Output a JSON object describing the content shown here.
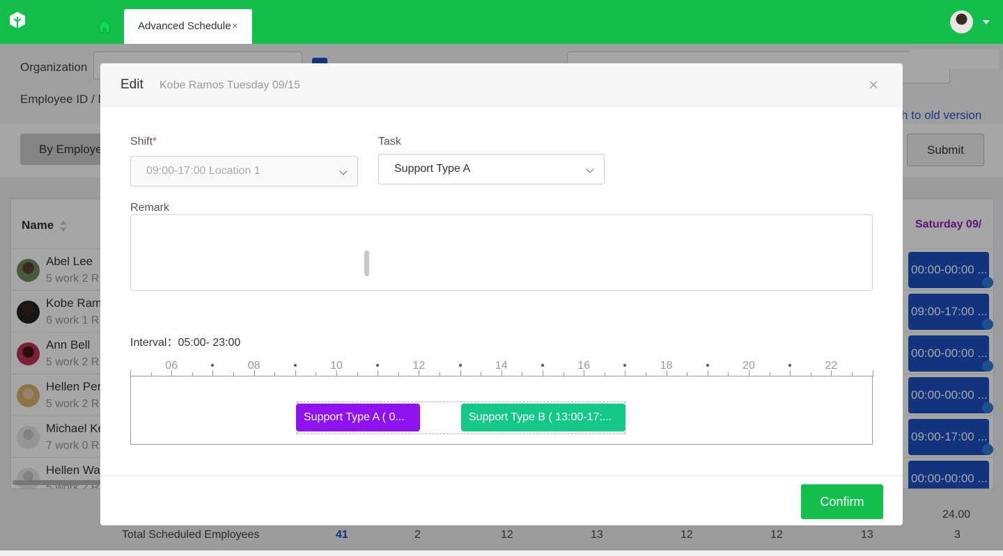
{
  "colors": {
    "brand_green": "#14be4b",
    "shift_blue": "#1d4fc2",
    "task_a_purple": "#8f12f0",
    "task_b_teal": "#14c987",
    "weekend_purple": "#8d1fb5"
  },
  "header": {
    "tab_label": "Advanced Schedule",
    "tab_close": "×",
    "icons": [
      "tree-logo-icon",
      "home-icon",
      "user-avatar",
      "caret-down-icon"
    ]
  },
  "filters": {
    "organization_label": "Organization",
    "employee_label": "Employee ID / N",
    "old_version_link": "h to old version"
  },
  "toolbar": {
    "by_employee": "By Employe",
    "submit": "Submit"
  },
  "table": {
    "name_header": "Name",
    "saturday_header": "Saturday 09/",
    "rows": [
      {
        "name": "Abel Lee",
        "sub": "5 work 2 R",
        "shift": "00:00-00:00 ..."
      },
      {
        "name": "Kobe Ram",
        "sub": "6 work 1 R",
        "shift": "09:00-17:00 ..."
      },
      {
        "name": "Ann Bell",
        "sub": "5 work 2 R",
        "shift": "00:00-00:00 ..."
      },
      {
        "name": "Hellen Per",
        "sub": "5 work 2 R",
        "shift": "00:00-00:00 ..."
      },
      {
        "name": "Michael Ke",
        "sub": "7 work 0 R",
        "shift": "09:00-17:00 ..."
      },
      {
        "name": "Hellen Wa",
        "sub": "5 work 2 R",
        "shift": "00:00-00:00 ..."
      }
    ]
  },
  "footer": {
    "extra_total": "24.00",
    "label": "Total Scheduled Employees",
    "values": [
      "41",
      "2",
      "12",
      "13",
      "12",
      "12",
      "13",
      "3"
    ]
  },
  "modal": {
    "title": "Edit",
    "subtitle": "Kobe Ramos Tuesday 09/15",
    "close": "×",
    "shift_label": "Shift",
    "required_mark": "*",
    "shift_value": "09:00-17:00 Location 1",
    "task_label": "Task",
    "task_value": "Support Type A",
    "remark_label": "Remark",
    "remark_value": "",
    "interval_text": "Interval：05:00- 23:00",
    "ruler_labels": [
      "06",
      "08",
      "10",
      "12",
      "14",
      "16",
      "18",
      "20",
      "22"
    ],
    "blocks": [
      {
        "label": "Support Type A ( 0...",
        "color": "#8f12f0"
      },
      {
        "label": "Support Type B ( 13:00-17:...",
        "color": "#14c987"
      }
    ],
    "confirm": "Confirm"
  }
}
